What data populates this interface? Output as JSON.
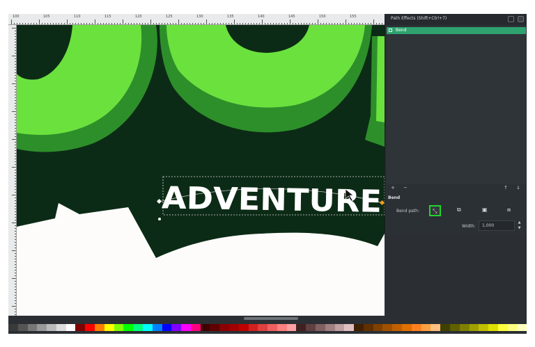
{
  "ruler": {
    "top_labels": [
      "100",
      "105",
      "110",
      "115",
      "120",
      "125",
      "130",
      "135",
      "140",
      "145",
      "150",
      "155"
    ]
  },
  "canvas": {
    "artwork_text": "ADVENTURE",
    "colors": {
      "background": "#0c2b16",
      "light_green": "#6be13e",
      "mid_green": "#2d8f2a",
      "white": "#fdfcfa"
    }
  },
  "panel": {
    "title": "Path Effects  (Shift+Ctrl+7)",
    "effects": [
      {
        "label": "Bend",
        "enabled": true
      }
    ],
    "list_buttons": {
      "add": "+",
      "remove": "−",
      "move_up": "↑",
      "move_down": "↓"
    },
    "section_title": "Bend",
    "bend_path_label": "Bend path:",
    "width_label": "Width:",
    "width_value": "1,000",
    "accent_color": "#2ea36f",
    "highlight_color": "#20d62a"
  },
  "palette": [
    "#3a3a3a",
    "#555555",
    "#777777",
    "#999999",
    "#bbbbbb",
    "#dddddd",
    "#ffffff",
    "#800000",
    "#ff0000",
    "#ff8000",
    "#ffff00",
    "#80ff00",
    "#00ff00",
    "#00ff80",
    "#00ffff",
    "#0080ff",
    "#0000ff",
    "#8000ff",
    "#ff00ff",
    "#ff0080",
    "#400000",
    "#600000",
    "#8b0000",
    "#a00000",
    "#c00000",
    "#d02020",
    "#e04040",
    "#f06060",
    "#ff8080",
    "#ffa0a0",
    "#402020",
    "#604040",
    "#806060",
    "#a08080",
    "#c0a0a0",
    "#e0c0c0",
    "#402000",
    "#603000",
    "#804000",
    "#a05000",
    "#c06000",
    "#e07000",
    "#ff8020",
    "#ffa040",
    "#ffc080",
    "#404000",
    "#606000",
    "#808000",
    "#a0a000",
    "#c0c000",
    "#e0e000",
    "#ffff40",
    "#ffff80",
    "#ffffc0"
  ]
}
